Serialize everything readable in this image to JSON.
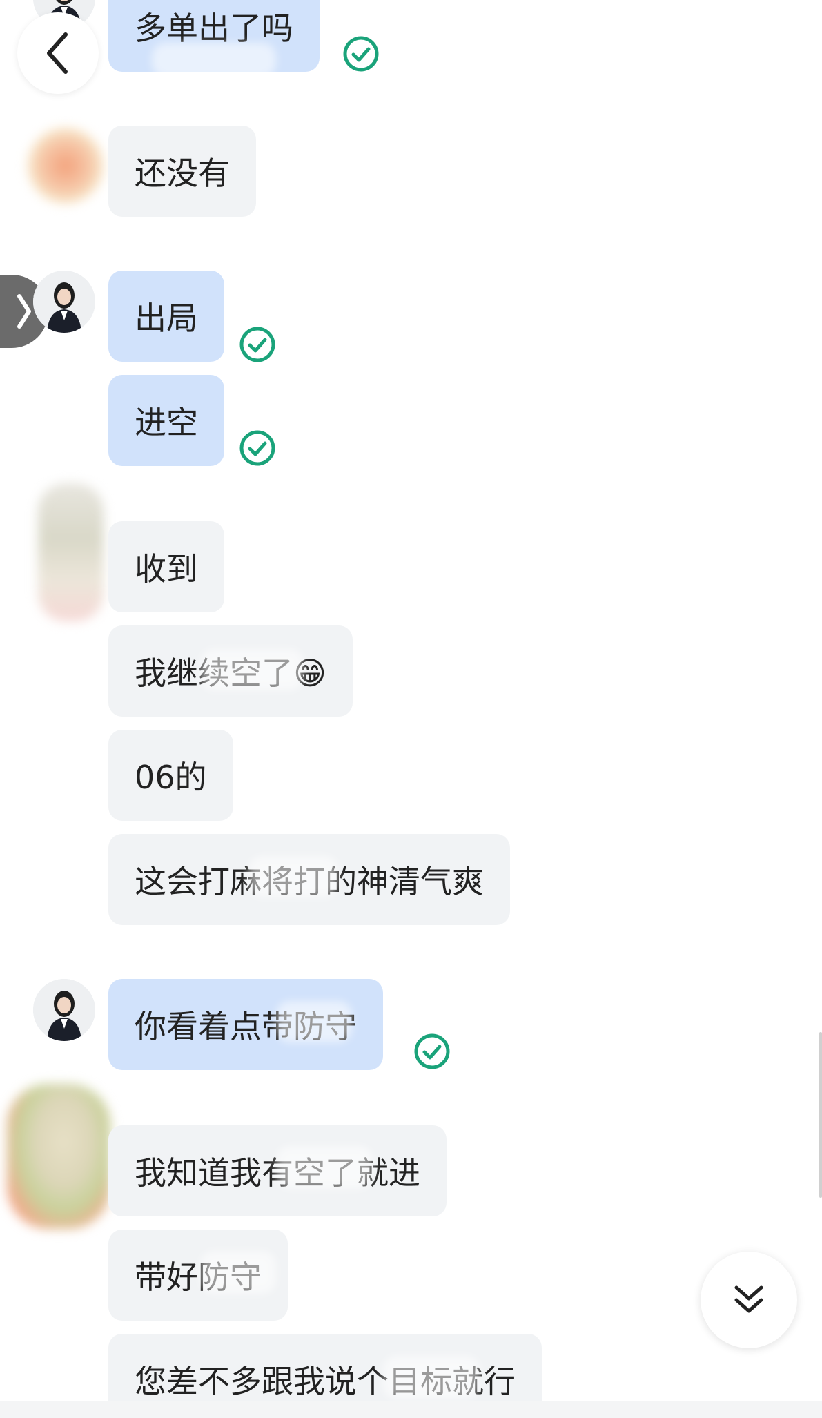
{
  "colors": {
    "self_bubble": "#d1e2fb",
    "other_bubble": "#f1f3f5",
    "check_green": "#1aa37a",
    "text": "#222222"
  },
  "icons": {
    "back": "chevron-left-icon",
    "side_tab": "chevron-right-icon",
    "scroll_down": "double-chevron-down-icon",
    "read_receipt": "check-circle-icon"
  },
  "messages": [
    {
      "sender": "self",
      "text": "多单出了吗",
      "read": true
    },
    {
      "sender": "other",
      "text": "还没有"
    },
    {
      "sender": "self",
      "text": "出局",
      "read": true
    },
    {
      "sender": "self",
      "text": "进空",
      "read": true
    },
    {
      "sender": "other",
      "text": "收到"
    },
    {
      "sender": "other",
      "text": "我继续空了😁"
    },
    {
      "sender": "other",
      "text": "06的"
    },
    {
      "sender": "other",
      "text": "这会打麻将打的神清气爽"
    },
    {
      "sender": "self",
      "text": "你看着点带防守",
      "read": true
    },
    {
      "sender": "other",
      "text": "我知道我有空了就进"
    },
    {
      "sender": "other",
      "text": "带好防守"
    },
    {
      "sender": "other",
      "text": "您差不多跟我说个目标就行"
    }
  ]
}
